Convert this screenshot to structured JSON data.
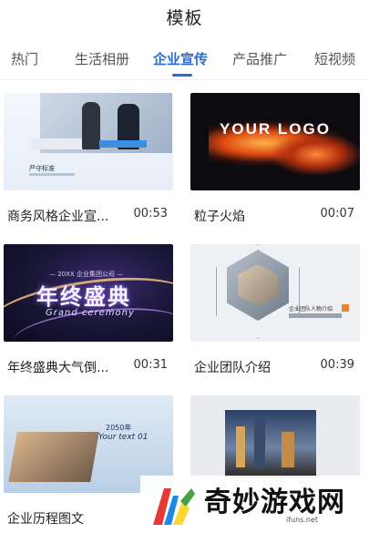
{
  "header": {
    "title": "模板"
  },
  "tabs": [
    {
      "label": "热门"
    },
    {
      "label": "生活相册"
    },
    {
      "label": "企业宣传",
      "active": true
    },
    {
      "label": "产品推广"
    },
    {
      "label": "短视频"
    }
  ],
  "templates": [
    {
      "name": "商务风格企业宣...",
      "duration": "00:53",
      "thumb_text": "严守标准"
    },
    {
      "name": "粒子火焰",
      "duration": "00:07",
      "thumb_text": "YOUR LOGO"
    },
    {
      "name": "年终盛典大气倒...",
      "duration": "00:31",
      "thumb_text": "年终盛典",
      "thumb_sub": "Grand ceremony",
      "thumb_top": "— 20XX 企业集团公司 —"
    },
    {
      "name": "企业团队介绍",
      "duration": "00:39",
      "thumb_text": "企业团队人物介绍"
    },
    {
      "name": "企业历程图文",
      "duration": "",
      "thumb_text": "Your text 01",
      "thumb_year": "2050年"
    },
    {
      "name": "",
      "duration": "",
      "thumb_text": ""
    }
  ],
  "watermark": {
    "text": "奇妙游戏网",
    "url": "ifuns.net"
  },
  "colors": {
    "accent": "#2b6bd6"
  }
}
